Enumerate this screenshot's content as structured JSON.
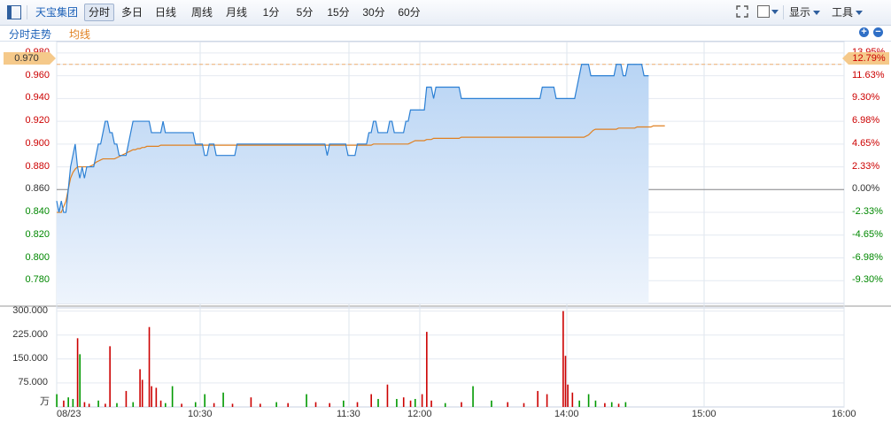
{
  "toolbar": {
    "stock_name": "天宝集团",
    "tabs": [
      "分时",
      "多日",
      "日线",
      "周线",
      "月线",
      "1分",
      "5分",
      "15分",
      "30分",
      "60分"
    ],
    "active_tab": "分时",
    "display_label": "显示",
    "tools_label": "工具"
  },
  "legend": {
    "trend_label": "分时走势",
    "avg_label": "均线"
  },
  "current": {
    "price": "0.970",
    "pct": "12.79%"
  },
  "colors": {
    "up": "#cc0000",
    "down": "#009900",
    "price_line": "#2a7fd4",
    "avg_line": "#e08020",
    "accent": "#1c61b8"
  },
  "chart_data": [
    {
      "type": "line",
      "title": "",
      "ylim": [
        0.76,
        0.99
      ],
      "prev_close": 0.86,
      "left_ticks": [
        "0.980",
        "0.970",
        "0.960",
        "0.940",
        "0.920",
        "0.900",
        "0.880",
        "0.860",
        "0.840",
        "0.820",
        "0.800",
        "0.780"
      ],
      "right_ticks": [
        "13.95%",
        "12.79%",
        "11.63%",
        "9.30%",
        "6.98%",
        "4.65%",
        "2.33%",
        "0.00%",
        "-2.33%",
        "-4.65%",
        "-6.98%",
        "-9.30%"
      ],
      "x_ticks": [
        "08/23",
        "10:30",
        "11:30",
        "12:00",
        "14:00",
        "15:00",
        "16:00"
      ],
      "series": [
        {
          "name": "分时走势",
          "values": [
            0.85,
            0.84,
            0.85,
            0.84,
            0.84,
            0.86,
            0.88,
            0.89,
            0.9,
            0.88,
            0.87,
            0.88,
            0.87,
            0.88,
            0.88,
            0.88,
            0.88,
            0.89,
            0.9,
            0.9,
            0.91,
            0.92,
            0.92,
            0.91,
            0.91,
            0.9,
            0.9,
            0.89,
            0.89,
            0.89,
            0.89,
            0.9,
            0.91,
            0.92,
            0.92,
            0.92,
            0.92,
            0.92,
            0.92,
            0.92,
            0.92,
            0.91,
            0.91,
            0.91,
            0.91,
            0.91,
            0.92,
            0.91,
            0.91,
            0.91,
            0.91,
            0.91,
            0.91,
            0.91,
            0.91,
            0.91,
            0.91,
            0.91,
            0.91,
            0.91,
            0.9,
            0.9,
            0.9,
            0.9,
            0.89,
            0.89,
            0.9,
            0.9,
            0.9,
            0.89,
            0.89,
            0.89,
            0.89,
            0.89,
            0.89,
            0.89,
            0.89,
            0.89,
            0.9,
            0.9,
            0.9,
            0.9,
            0.9,
            0.9,
            0.9,
            0.9,
            0.9,
            0.9,
            0.9,
            0.9,
            0.9,
            0.9,
            0.9,
            0.9,
            0.9,
            0.9,
            0.9,
            0.9,
            0.9,
            0.9,
            0.9,
            0.9,
            0.9,
            0.9,
            0.9,
            0.9,
            0.9,
            0.9,
            0.9,
            0.9,
            0.9,
            0.9,
            0.9,
            0.9,
            0.9,
            0.9,
            0.9,
            0.89,
            0.9,
            0.9,
            0.9,
            0.9,
            0.9,
            0.9,
            0.9,
            0.9,
            0.89,
            0.89,
            0.89,
            0.89,
            0.9,
            0.9,
            0.9,
            0.9,
            0.9,
            0.91,
            0.91,
            0.92,
            0.92,
            0.91,
            0.91,
            0.91,
            0.91,
            0.91,
            0.92,
            0.92,
            0.91,
            0.91,
            0.91,
            0.91,
            0.91,
            0.92,
            0.92,
            0.93,
            0.93,
            0.93,
            0.93,
            0.93,
            0.93,
            0.93,
            0.95,
            0.95,
            0.95,
            0.94,
            0.95,
            0.95,
            0.95,
            0.95,
            0.95,
            0.95,
            0.95,
            0.95,
            0.95,
            0.95,
            0.95,
            0.94,
            0.94,
            0.94,
            0.94,
            0.94,
            0.94,
            0.94,
            0.94,
            0.94,
            0.94,
            0.94,
            0.94,
            0.94,
            0.94,
            0.94,
            0.94,
            0.94,
            0.94,
            0.94,
            0.94,
            0.94,
            0.94,
            0.94,
            0.94,
            0.94,
            0.94,
            0.94,
            0.94,
            0.94,
            0.94,
            0.94,
            0.94,
            0.94,
            0.94,
            0.94,
            0.95,
            0.95,
            0.95,
            0.95,
            0.95,
            0.95,
            0.94,
            0.94,
            0.94,
            0.94,
            0.94,
            0.94,
            0.94,
            0.94,
            0.94,
            0.95,
            0.96,
            0.97,
            0.97,
            0.97,
            0.97,
            0.96,
            0.96,
            0.96,
            0.96,
            0.96,
            0.96,
            0.96,
            0.96,
            0.96,
            0.96,
            0.96,
            0.97,
            0.97,
            0.97,
            0.96,
            0.96,
            0.97,
            0.97,
            0.97,
            0.97,
            0.97,
            0.97,
            0.97,
            0.96,
            0.96,
            0.96
          ]
        },
        {
          "name": "均线",
          "values": [
            0.84,
            0.84,
            0.84,
            0.845,
            0.85,
            0.86,
            0.87,
            0.875,
            0.878,
            0.88,
            0.88,
            0.88,
            0.88,
            0.88,
            0.88,
            0.881,
            0.882,
            0.884,
            0.885,
            0.886,
            0.887,
            0.887,
            0.887,
            0.887,
            0.887,
            0.887,
            0.888,
            0.889,
            0.89,
            0.891,
            0.892,
            0.893,
            0.894,
            0.895,
            0.895,
            0.896,
            0.896,
            0.897,
            0.897,
            0.898,
            0.898,
            0.898,
            0.898,
            0.898,
            0.898,
            0.899,
            0.899,
            0.899,
            0.899,
            0.899,
            0.899,
            0.899,
            0.899,
            0.899,
            0.899,
            0.899,
            0.899,
            0.899,
            0.899,
            0.899,
            0.899,
            0.899,
            0.899,
            0.899,
            0.899,
            0.899,
            0.899,
            0.899,
            0.899,
            0.899,
            0.899,
            0.899,
            0.899,
            0.899,
            0.899,
            0.899,
            0.899,
            0.899,
            0.899,
            0.899,
            0.899,
            0.899,
            0.899,
            0.899,
            0.899,
            0.899,
            0.899,
            0.899,
            0.899,
            0.899,
            0.899,
            0.899,
            0.899,
            0.899,
            0.899,
            0.899,
            0.899,
            0.899,
            0.899,
            0.899,
            0.899,
            0.899,
            0.899,
            0.899,
            0.899,
            0.899,
            0.899,
            0.899,
            0.899,
            0.899,
            0.899,
            0.899,
            0.899,
            0.899,
            0.899,
            0.899,
            0.899,
            0.899,
            0.899,
            0.899,
            0.899,
            0.899,
            0.899,
            0.899,
            0.899,
            0.899,
            0.899,
            0.899,
            0.899,
            0.899,
            0.899,
            0.899,
            0.899,
            0.899,
            0.899,
            0.899,
            0.899,
            0.9,
            0.9,
            0.9,
            0.9,
            0.9,
            0.9,
            0.9,
            0.9,
            0.9,
            0.9,
            0.9,
            0.9,
            0.9,
            0.9,
            0.9,
            0.9,
            0.901,
            0.902,
            0.903,
            0.903,
            0.903,
            0.903,
            0.903,
            0.904,
            0.904,
            0.904,
            0.905,
            0.905,
            0.905,
            0.905,
            0.905,
            0.905,
            0.905,
            0.905,
            0.905,
            0.905,
            0.905,
            0.905,
            0.906,
            0.906,
            0.906,
            0.906,
            0.906,
            0.906,
            0.906,
            0.906,
            0.906,
            0.906,
            0.906,
            0.906,
            0.906,
            0.906,
            0.906,
            0.906,
            0.906,
            0.906,
            0.906,
            0.906,
            0.906,
            0.906,
            0.906,
            0.906,
            0.906,
            0.906,
            0.906,
            0.906,
            0.906,
            0.906,
            0.906,
            0.906,
            0.906,
            0.906,
            0.906,
            0.906,
            0.906,
            0.906,
            0.906,
            0.906,
            0.906,
            0.906,
            0.906,
            0.906,
            0.906,
            0.906,
            0.906,
            0.906,
            0.906,
            0.906,
            0.906,
            0.906,
            0.906,
            0.906,
            0.907,
            0.908,
            0.91,
            0.912,
            0.913,
            0.913,
            0.913,
            0.913,
            0.913,
            0.913,
            0.913,
            0.913,
            0.913,
            0.913,
            0.914,
            0.914,
            0.914,
            0.914,
            0.914,
            0.914,
            0.914,
            0.914,
            0.915,
            0.915,
            0.915,
            0.915,
            0.915,
            0.915,
            0.915,
            0.916,
            0.916,
            0.916,
            0.916,
            0.916,
            0.916
          ]
        }
      ]
    },
    {
      "type": "bar",
      "title": "",
      "unit_label": "万",
      "ylim": [
        0,
        310
      ],
      "y_ticks": [
        "300.000",
        "225.000",
        "150.000",
        "75.000"
      ],
      "bars": [
        {
          "i": 0,
          "v": 40,
          "c": "down"
        },
        {
          "i": 3,
          "v": 20,
          "c": "up"
        },
        {
          "i": 5,
          "v": 30,
          "c": "down"
        },
        {
          "i": 7,
          "v": 25,
          "c": "down"
        },
        {
          "i": 9,
          "v": 215,
          "c": "up"
        },
        {
          "i": 10,
          "v": 165,
          "c": "down"
        },
        {
          "i": 12,
          "v": 15,
          "c": "up"
        },
        {
          "i": 14,
          "v": 10,
          "c": "up"
        },
        {
          "i": 18,
          "v": 20,
          "c": "down"
        },
        {
          "i": 21,
          "v": 10,
          "c": "up"
        },
        {
          "i": 23,
          "v": 190,
          "c": "up"
        },
        {
          "i": 26,
          "v": 12,
          "c": "down"
        },
        {
          "i": 30,
          "v": 50,
          "c": "up"
        },
        {
          "i": 33,
          "v": 15,
          "c": "down"
        },
        {
          "i": 36,
          "v": 118,
          "c": "up"
        },
        {
          "i": 37,
          "v": 85,
          "c": "up"
        },
        {
          "i": 40,
          "v": 250,
          "c": "up"
        },
        {
          "i": 41,
          "v": 65,
          "c": "up"
        },
        {
          "i": 43,
          "v": 60,
          "c": "up"
        },
        {
          "i": 45,
          "v": 20,
          "c": "up"
        },
        {
          "i": 47,
          "v": 12,
          "c": "down"
        },
        {
          "i": 50,
          "v": 65,
          "c": "down"
        },
        {
          "i": 54,
          "v": 10,
          "c": "up"
        },
        {
          "i": 60,
          "v": 15,
          "c": "down"
        },
        {
          "i": 64,
          "v": 40,
          "c": "down"
        },
        {
          "i": 68,
          "v": 12,
          "c": "up"
        },
        {
          "i": 72,
          "v": 45,
          "c": "down"
        },
        {
          "i": 76,
          "v": 10,
          "c": "up"
        },
        {
          "i": 84,
          "v": 30,
          "c": "up"
        },
        {
          "i": 88,
          "v": 10,
          "c": "up"
        },
        {
          "i": 95,
          "v": 15,
          "c": "down"
        },
        {
          "i": 100,
          "v": 12,
          "c": "up"
        },
        {
          "i": 108,
          "v": 40,
          "c": "down"
        },
        {
          "i": 112,
          "v": 15,
          "c": "up"
        },
        {
          "i": 118,
          "v": 12,
          "c": "up"
        },
        {
          "i": 124,
          "v": 20,
          "c": "down"
        },
        {
          "i": 130,
          "v": 15,
          "c": "up"
        },
        {
          "i": 136,
          "v": 40,
          "c": "up"
        },
        {
          "i": 139,
          "v": 25,
          "c": "down"
        },
        {
          "i": 143,
          "v": 70,
          "c": "up"
        },
        {
          "i": 147,
          "v": 25,
          "c": "down"
        },
        {
          "i": 150,
          "v": 30,
          "c": "up"
        },
        {
          "i": 153,
          "v": 20,
          "c": "up"
        },
        {
          "i": 155,
          "v": 25,
          "c": "down"
        },
        {
          "i": 158,
          "v": 40,
          "c": "up"
        },
        {
          "i": 160,
          "v": 235,
          "c": "up"
        },
        {
          "i": 162,
          "v": 20,
          "c": "up"
        },
        {
          "i": 168,
          "v": 12,
          "c": "down"
        },
        {
          "i": 175,
          "v": 15,
          "c": "up"
        },
        {
          "i": 180,
          "v": 65,
          "c": "down"
        },
        {
          "i": 188,
          "v": 20,
          "c": "down"
        },
        {
          "i": 195,
          "v": 15,
          "c": "up"
        },
        {
          "i": 202,
          "v": 12,
          "c": "up"
        },
        {
          "i": 208,
          "v": 50,
          "c": "up"
        },
        {
          "i": 212,
          "v": 40,
          "c": "up"
        },
        {
          "i": 219,
          "v": 300,
          "c": "up"
        },
        {
          "i": 220,
          "v": 160,
          "c": "up"
        },
        {
          "i": 221,
          "v": 70,
          "c": "up"
        },
        {
          "i": 223,
          "v": 45,
          "c": "up"
        },
        {
          "i": 226,
          "v": 20,
          "c": "down"
        },
        {
          "i": 230,
          "v": 40,
          "c": "down"
        },
        {
          "i": 233,
          "v": 20,
          "c": "down"
        },
        {
          "i": 237,
          "v": 12,
          "c": "up"
        },
        {
          "i": 240,
          "v": 15,
          "c": "down"
        },
        {
          "i": 243,
          "v": 10,
          "c": "up"
        },
        {
          "i": 246,
          "v": 15,
          "c": "down"
        }
      ]
    }
  ]
}
